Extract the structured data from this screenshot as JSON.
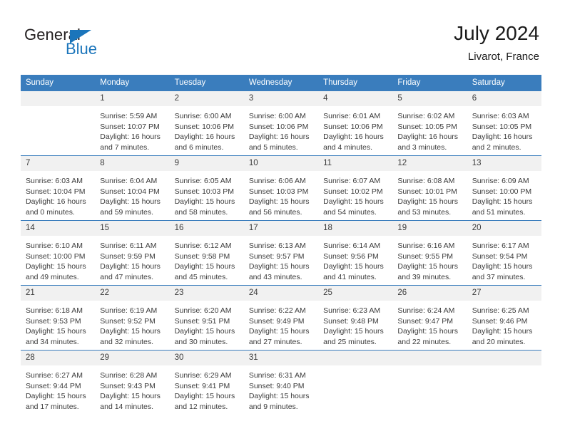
{
  "brand": {
    "name_part1": "General",
    "name_part2": "Blue",
    "triangle_icon": "triangle-icon",
    "color_dark": "#231f20",
    "color_blue": "#1b75bb"
  },
  "header": {
    "title": "July 2024",
    "location": "Livarot, France",
    "header_bg": "#3a7dbd",
    "daynum_bg": "#f1f1f1"
  },
  "weekdays": [
    "Sunday",
    "Monday",
    "Tuesday",
    "Wednesday",
    "Thursday",
    "Friday",
    "Saturday"
  ],
  "labels": {
    "sunrise": "Sunrise:",
    "sunset": "Sunset:",
    "daylight": "Daylight:"
  },
  "weeks": [
    [
      {
        "day": "",
        "sunrise": "",
        "sunset": "",
        "daylight1": "",
        "daylight2": ""
      },
      {
        "day": "1",
        "sunrise": "Sunrise: 5:59 AM",
        "sunset": "Sunset: 10:07 PM",
        "daylight1": "Daylight: 16 hours",
        "daylight2": "and 7 minutes."
      },
      {
        "day": "2",
        "sunrise": "Sunrise: 6:00 AM",
        "sunset": "Sunset: 10:06 PM",
        "daylight1": "Daylight: 16 hours",
        "daylight2": "and 6 minutes."
      },
      {
        "day": "3",
        "sunrise": "Sunrise: 6:00 AM",
        "sunset": "Sunset: 10:06 PM",
        "daylight1": "Daylight: 16 hours",
        "daylight2": "and 5 minutes."
      },
      {
        "day": "4",
        "sunrise": "Sunrise: 6:01 AM",
        "sunset": "Sunset: 10:06 PM",
        "daylight1": "Daylight: 16 hours",
        "daylight2": "and 4 minutes."
      },
      {
        "day": "5",
        "sunrise": "Sunrise: 6:02 AM",
        "sunset": "Sunset: 10:05 PM",
        "daylight1": "Daylight: 16 hours",
        "daylight2": "and 3 minutes."
      },
      {
        "day": "6",
        "sunrise": "Sunrise: 6:03 AM",
        "sunset": "Sunset: 10:05 PM",
        "daylight1": "Daylight: 16 hours",
        "daylight2": "and 2 minutes."
      }
    ],
    [
      {
        "day": "7",
        "sunrise": "Sunrise: 6:03 AM",
        "sunset": "Sunset: 10:04 PM",
        "daylight1": "Daylight: 16 hours",
        "daylight2": "and 0 minutes."
      },
      {
        "day": "8",
        "sunrise": "Sunrise: 6:04 AM",
        "sunset": "Sunset: 10:04 PM",
        "daylight1": "Daylight: 15 hours",
        "daylight2": "and 59 minutes."
      },
      {
        "day": "9",
        "sunrise": "Sunrise: 6:05 AM",
        "sunset": "Sunset: 10:03 PM",
        "daylight1": "Daylight: 15 hours",
        "daylight2": "and 58 minutes."
      },
      {
        "day": "10",
        "sunrise": "Sunrise: 6:06 AM",
        "sunset": "Sunset: 10:03 PM",
        "daylight1": "Daylight: 15 hours",
        "daylight2": "and 56 minutes."
      },
      {
        "day": "11",
        "sunrise": "Sunrise: 6:07 AM",
        "sunset": "Sunset: 10:02 PM",
        "daylight1": "Daylight: 15 hours",
        "daylight2": "and 54 minutes."
      },
      {
        "day": "12",
        "sunrise": "Sunrise: 6:08 AM",
        "sunset": "Sunset: 10:01 PM",
        "daylight1": "Daylight: 15 hours",
        "daylight2": "and 53 minutes."
      },
      {
        "day": "13",
        "sunrise": "Sunrise: 6:09 AM",
        "sunset": "Sunset: 10:00 PM",
        "daylight1": "Daylight: 15 hours",
        "daylight2": "and 51 minutes."
      }
    ],
    [
      {
        "day": "14",
        "sunrise": "Sunrise: 6:10 AM",
        "sunset": "Sunset: 10:00 PM",
        "daylight1": "Daylight: 15 hours",
        "daylight2": "and 49 minutes."
      },
      {
        "day": "15",
        "sunrise": "Sunrise: 6:11 AM",
        "sunset": "Sunset: 9:59 PM",
        "daylight1": "Daylight: 15 hours",
        "daylight2": "and 47 minutes."
      },
      {
        "day": "16",
        "sunrise": "Sunrise: 6:12 AM",
        "sunset": "Sunset: 9:58 PM",
        "daylight1": "Daylight: 15 hours",
        "daylight2": "and 45 minutes."
      },
      {
        "day": "17",
        "sunrise": "Sunrise: 6:13 AM",
        "sunset": "Sunset: 9:57 PM",
        "daylight1": "Daylight: 15 hours",
        "daylight2": "and 43 minutes."
      },
      {
        "day": "18",
        "sunrise": "Sunrise: 6:14 AM",
        "sunset": "Sunset: 9:56 PM",
        "daylight1": "Daylight: 15 hours",
        "daylight2": "and 41 minutes."
      },
      {
        "day": "19",
        "sunrise": "Sunrise: 6:16 AM",
        "sunset": "Sunset: 9:55 PM",
        "daylight1": "Daylight: 15 hours",
        "daylight2": "and 39 minutes."
      },
      {
        "day": "20",
        "sunrise": "Sunrise: 6:17 AM",
        "sunset": "Sunset: 9:54 PM",
        "daylight1": "Daylight: 15 hours",
        "daylight2": "and 37 minutes."
      }
    ],
    [
      {
        "day": "21",
        "sunrise": "Sunrise: 6:18 AM",
        "sunset": "Sunset: 9:53 PM",
        "daylight1": "Daylight: 15 hours",
        "daylight2": "and 34 minutes."
      },
      {
        "day": "22",
        "sunrise": "Sunrise: 6:19 AM",
        "sunset": "Sunset: 9:52 PM",
        "daylight1": "Daylight: 15 hours",
        "daylight2": "and 32 minutes."
      },
      {
        "day": "23",
        "sunrise": "Sunrise: 6:20 AM",
        "sunset": "Sunset: 9:51 PM",
        "daylight1": "Daylight: 15 hours",
        "daylight2": "and 30 minutes."
      },
      {
        "day": "24",
        "sunrise": "Sunrise: 6:22 AM",
        "sunset": "Sunset: 9:49 PM",
        "daylight1": "Daylight: 15 hours",
        "daylight2": "and 27 minutes."
      },
      {
        "day": "25",
        "sunrise": "Sunrise: 6:23 AM",
        "sunset": "Sunset: 9:48 PM",
        "daylight1": "Daylight: 15 hours",
        "daylight2": "and 25 minutes."
      },
      {
        "day": "26",
        "sunrise": "Sunrise: 6:24 AM",
        "sunset": "Sunset: 9:47 PM",
        "daylight1": "Daylight: 15 hours",
        "daylight2": "and 22 minutes."
      },
      {
        "day": "27",
        "sunrise": "Sunrise: 6:25 AM",
        "sunset": "Sunset: 9:46 PM",
        "daylight1": "Daylight: 15 hours",
        "daylight2": "and 20 minutes."
      }
    ],
    [
      {
        "day": "28",
        "sunrise": "Sunrise: 6:27 AM",
        "sunset": "Sunset: 9:44 PM",
        "daylight1": "Daylight: 15 hours",
        "daylight2": "and 17 minutes."
      },
      {
        "day": "29",
        "sunrise": "Sunrise: 6:28 AM",
        "sunset": "Sunset: 9:43 PM",
        "daylight1": "Daylight: 15 hours",
        "daylight2": "and 14 minutes."
      },
      {
        "day": "30",
        "sunrise": "Sunrise: 6:29 AM",
        "sunset": "Sunset: 9:41 PM",
        "daylight1": "Daylight: 15 hours",
        "daylight2": "and 12 minutes."
      },
      {
        "day": "31",
        "sunrise": "Sunrise: 6:31 AM",
        "sunset": "Sunset: 9:40 PM",
        "daylight1": "Daylight: 15 hours",
        "daylight2": "and 9 minutes."
      },
      {
        "day": "",
        "sunrise": "",
        "sunset": "",
        "daylight1": "",
        "daylight2": ""
      },
      {
        "day": "",
        "sunrise": "",
        "sunset": "",
        "daylight1": "",
        "daylight2": ""
      },
      {
        "day": "",
        "sunrise": "",
        "sunset": "",
        "daylight1": "",
        "daylight2": ""
      }
    ]
  ]
}
